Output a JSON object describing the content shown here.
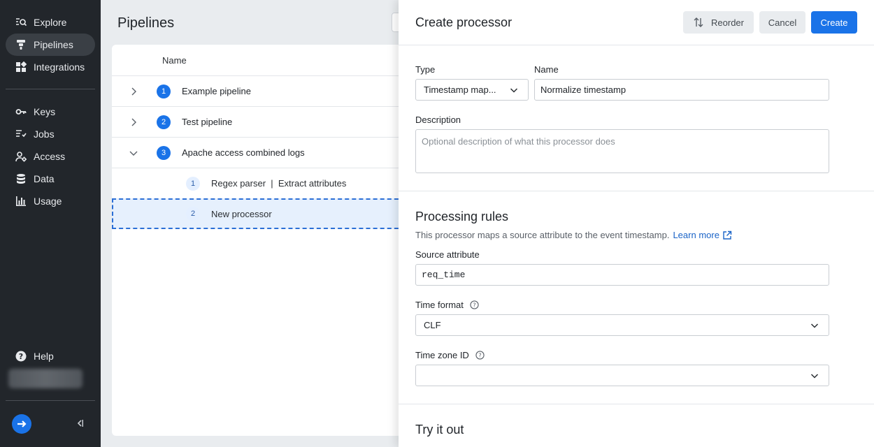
{
  "sidebar": {
    "items": [
      {
        "label": "Explore",
        "icon": "explore-icon"
      },
      {
        "label": "Pipelines",
        "icon": "pipelines-icon",
        "active": true
      },
      {
        "label": "Integrations",
        "icon": "integrations-icon"
      },
      {
        "label": "Keys",
        "icon": "key-icon"
      },
      {
        "label": "Jobs",
        "icon": "jobs-icon"
      },
      {
        "label": "Access",
        "icon": "access-icon"
      },
      {
        "label": "Data",
        "icon": "database-icon"
      },
      {
        "label": "Usage",
        "icon": "bar-chart-icon"
      }
    ],
    "help_label": "Help"
  },
  "main": {
    "title": "Pipelines",
    "column_name": "Name",
    "pipelines": [
      {
        "number": "1",
        "name": "Example pipeline"
      },
      {
        "number": "2",
        "name": "Test pipeline"
      },
      {
        "number": "3",
        "name": "Apache access combined logs"
      }
    ],
    "processors": [
      {
        "number": "1",
        "name": "Regex parser  |  Extract attributes"
      },
      {
        "number": "2",
        "name": "New processor"
      }
    ]
  },
  "drawer": {
    "title": "Create processor",
    "reorder_label": "Reorder",
    "cancel_label": "Cancel",
    "create_label": "Create",
    "type_label": "Type",
    "type_value": "Timestamp map...",
    "name_label": "Name",
    "name_value": "Normalize timestamp",
    "description_label": "Description",
    "description_placeholder": "Optional description of what this processor does",
    "rules_title": "Processing rules",
    "rules_desc": "This processor maps a source attribute to the event timestamp.",
    "learn_more": "Learn more",
    "source_label": "Source attribute",
    "source_value": "req_time",
    "time_format_label": "Time format",
    "time_format_value": "CLF",
    "timezone_label": "Time zone ID",
    "timezone_value": "",
    "try_title": "Try it out"
  },
  "colors": {
    "sidebar_bg": "#22262b",
    "accent": "#1a73e8"
  }
}
